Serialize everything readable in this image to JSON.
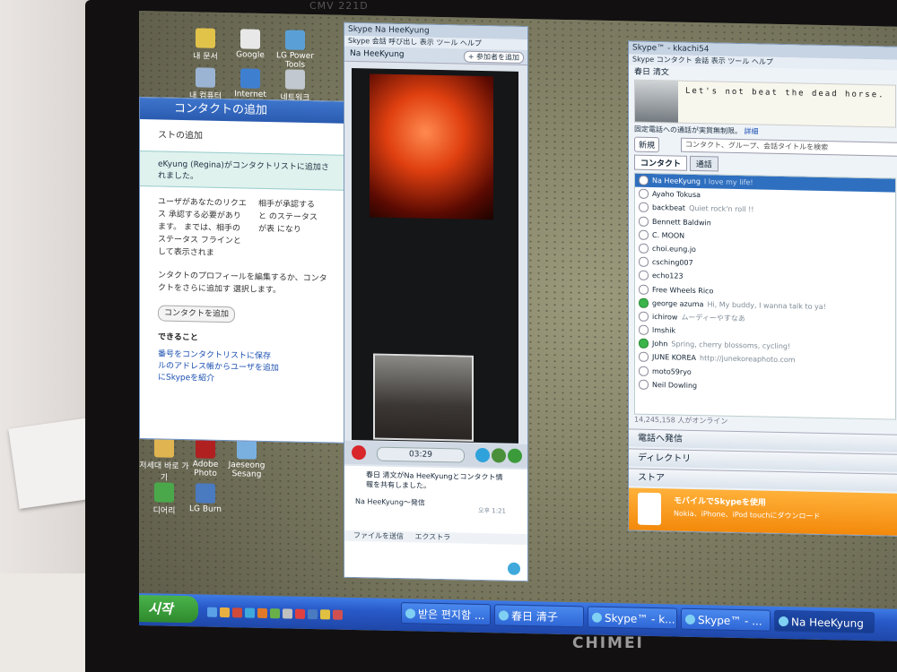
{
  "monitor": {
    "brand": "CHIMEI",
    "model": "CMV 221D"
  },
  "desktop_icons": [
    {
      "label": "내 문서",
      "color": "#e2c34a"
    },
    {
      "label": "Google",
      "color": "#e8e8e8"
    },
    {
      "label": "LG Power Tools",
      "color": "#5aa0d6"
    },
    {
      "label": "내 컴퓨터",
      "color": "#9cb4d4"
    },
    {
      "label": "Internet Explorer",
      "color": "#3f7fd0"
    },
    {
      "label": "네트워크",
      "color": "#c2c8cf"
    },
    {
      "label": "저세대 바로 가기",
      "color": "#e0b450"
    },
    {
      "label": "Adobe Photo",
      "color": "#b02020"
    },
    {
      "label": "Jaeseong Sesang",
      "color": "#7ab0e0"
    },
    {
      "label": "디어리",
      "color": "#4aa84a"
    },
    {
      "label": "LG Burn",
      "color": "#4a7ac0"
    }
  ],
  "add_contact_window": {
    "title": "コンタクトの追加",
    "subtitle": "ストの追加",
    "notice": "eKyung (Regina)がコンタクトリストに追加されました。",
    "body_left": "ユーザがあなたのリクエス 承認する必要があります。 までは、相手のステータス フラインとして表示されま",
    "body_right": "相手が承認すると のステータスが表 になり",
    "profile_text": "ンタクトのプロフィールを編集するか、コンタクトをさらに追加す 選択します。",
    "button": "コンタクトを追加",
    "next_heading": "できること",
    "links": [
      "番号をコンタクトリストに保存",
      "ルのアドレス帳からユーザを追加",
      "にSkypeを紹介"
    ]
  },
  "call_window": {
    "titlebar": "Skype  Na HeeKyung",
    "menu": "Skype  会話  呼び出し  表示  ツール  ヘルプ",
    "contact_name": "Na HeeKyung",
    "add_button": "+ 参加者を追加",
    "timer": "03:29",
    "message": "春日 清文がNa HeeKyungとコンタクト情報を共有しました。",
    "call_item": "Na HeeKyung～発信",
    "call_time": "오후 1:21",
    "bar_items": [
      "ファイルを送信",
      "エクストラ"
    ]
  },
  "skype_main": {
    "titlebar": "Skype™ - kkachi54",
    "menu": "Skype  コンタクト  会話  表示  ツール  ヘルプ",
    "me_name": "春日 清文",
    "mood": "Let's not beat the dead horse.",
    "landline_text": "固定電話への通話が実質無制限。",
    "landline_link": "詳細",
    "new_button": "新規",
    "search_placeholder": "コンタクト、グループ、会話タイトルを検索",
    "tabs": [
      "コンタクト",
      "通話"
    ],
    "contacts": [
      {
        "name": "Na HeeKyung",
        "mood": "I love my life!",
        "status": "away",
        "selected": true
      },
      {
        "name": "Ayaho Tokusa",
        "mood": "",
        "status": "offline"
      },
      {
        "name": "backbeat",
        "mood": "Quiet rock'n roll !!",
        "status": "offline"
      },
      {
        "name": "Bennett Baldwin",
        "mood": "",
        "status": "offline"
      },
      {
        "name": "C. MOON",
        "mood": "",
        "status": "offline"
      },
      {
        "name": "choi.eung.jo",
        "mood": "",
        "status": "offline"
      },
      {
        "name": "csching007",
        "mood": "",
        "status": "offline"
      },
      {
        "name": "echo123",
        "mood": "",
        "status": "offline"
      },
      {
        "name": "Free Wheels Rico",
        "mood": "",
        "status": "offline"
      },
      {
        "name": "george azuma",
        "mood": "Hi, My buddy, I wanna talk to ya!",
        "status": "online"
      },
      {
        "name": "ichirow",
        "mood": "ムーディーやすなあ",
        "status": "offline"
      },
      {
        "name": "lmshik",
        "mood": "",
        "status": "offline"
      },
      {
        "name": "John",
        "mood": "Spring, cherry blossoms, cycling!",
        "status": "online"
      },
      {
        "name": "JUNE KOREA",
        "mood": "http://junekoreaphoto.com",
        "status": "offline"
      },
      {
        "name": "moto59ryo",
        "mood": "",
        "status": "offline"
      },
      {
        "name": "Neil Dowling",
        "mood": "",
        "status": "offline"
      }
    ],
    "online_count": "14,245,158 人がオンライン",
    "sections": [
      "電話へ発信",
      "ディレクトリ",
      "ストア"
    ],
    "promo_title": "モバイルでSkypeを使用",
    "promo_text": "Nokia、iPhone、iPod touchにダウンロード"
  },
  "taskbar": {
    "start": "시작",
    "tasks": [
      "받은 편지함 ...",
      "春日 清子",
      "Skype™ - k...",
      "Skype™ - ...",
      "Na HeeKyung"
    ]
  }
}
